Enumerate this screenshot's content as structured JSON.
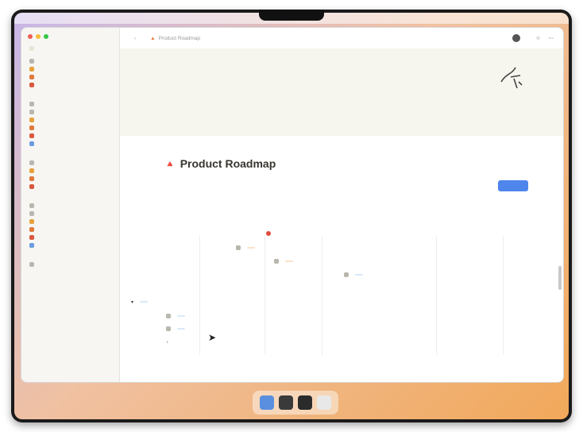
{
  "menubar": {
    "left": [
      "",
      "",
      "",
      "",
      ""
    ],
    "right": [
      "",
      "",
      "",
      ""
    ]
  },
  "sidebar": {
    "workspace": "",
    "top_items": [
      "",
      "",
      "",
      ""
    ],
    "section_favorites": "",
    "favorites": [
      "",
      "",
      "",
      "",
      "",
      ""
    ],
    "section_teamspace": "",
    "teamspace_items": [
      "",
      "",
      "",
      ""
    ],
    "section_shared": "",
    "shared_items": [
      "",
      "",
      "",
      "",
      "",
      ""
    ],
    "section_private": "",
    "private_items": [
      ""
    ]
  },
  "topbar": {
    "breadcrumb_parent": "",
    "breadcrumb_current": "Product Roadmap",
    "share_label": ""
  },
  "page": {
    "icon": "🔺",
    "title": "Product Roadmap",
    "new_button": "",
    "property_chips": [
      "",
      "",
      "",
      "",
      ""
    ],
    "view_tabs": [
      "",
      "",
      "",
      ""
    ],
    "timeline_controls": [
      "",
      "",
      ""
    ]
  },
  "timeline": {
    "tasks": [
      {
        "name": "",
        "tag": "",
        "tag_color": "orange"
      },
      {
        "name": "",
        "tag": "",
        "tag_color": "orange"
      },
      {
        "name": "",
        "tag": "",
        "tag_color": "blue"
      }
    ],
    "group": {
      "name": "",
      "tag": ""
    },
    "group_tasks": [
      {
        "name": "",
        "tag": ""
      },
      {
        "name": "",
        "tag": ""
      }
    ],
    "new_row": ""
  },
  "colors": {
    "accent": "#4f86ec",
    "today": "#e04b3c",
    "tag_orange": "#fbe2c7",
    "tag_blue": "#d9e9fb"
  }
}
